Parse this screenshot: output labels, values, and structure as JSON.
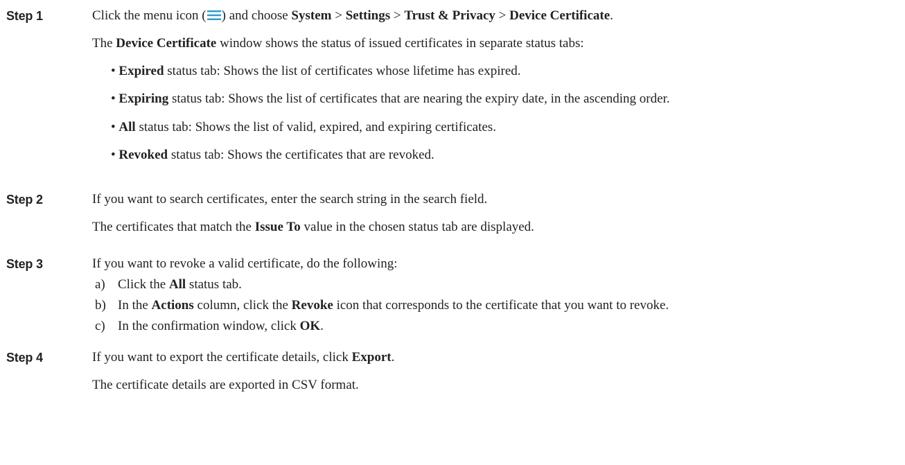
{
  "colors": {
    "text": "#222222",
    "menu_icon": "#1ba0d7"
  },
  "steps": [
    {
      "label": "Step 1",
      "line1": {
        "pre": "Click the menu icon (",
        "icon": "menu-icon",
        "post": ") and choose ",
        "p1": "System",
        "s1": " > ",
        "p2": "Settings",
        "s2": " > ",
        "p3": "Trust & Privacy",
        "s3": " > ",
        "p4": "Device Certificate",
        "end": "."
      },
      "line2": {
        "pre": "The ",
        "bold": "Device Certificate",
        "post": " window shows the status of issued certificates in separate status tabs:"
      },
      "bullets": [
        {
          "bold": "Expired",
          "text": " status tab: Shows the list of certificates whose lifetime has expired."
        },
        {
          "bold": "Expiring",
          "text": " status tab: Shows the list of certificates that are nearing the expiry date, in the ascending order."
        },
        {
          "bold": "All",
          "text": " status tab: Shows the list of valid, expired, and expiring certificates."
        },
        {
          "bold": "Revoked",
          "text": " status tab: Shows the certificates that are revoked."
        }
      ]
    },
    {
      "label": "Step 2",
      "line1": "If you want to search certificates, enter the search string in the search field.",
      "line2": {
        "pre": "The certificates that match the ",
        "bold": "Issue To",
        "post": " value in the chosen status tab are displayed."
      }
    },
    {
      "label": "Step 3",
      "line1": "If you want to revoke a valid certificate, do the following:",
      "substeps": [
        {
          "marker": "a)",
          "pre": "Click the ",
          "bold": "All",
          "post": " status tab."
        },
        {
          "marker": "b)",
          "pre": "In the ",
          "bold": "Actions",
          "mid": " column, click the ",
          "bold2": "Revoke",
          "post": " icon that corresponds to the certificate that you want to revoke."
        },
        {
          "marker": "c)",
          "pre": "In the confirmation window, click ",
          "bold": "OK",
          "post": "."
        }
      ]
    },
    {
      "label": "Step 4",
      "line1": {
        "pre": "If you want to export the certificate details, click ",
        "bold": "Export",
        "post": "."
      },
      "line2": "The certificate details are exported in CSV format."
    }
  ]
}
